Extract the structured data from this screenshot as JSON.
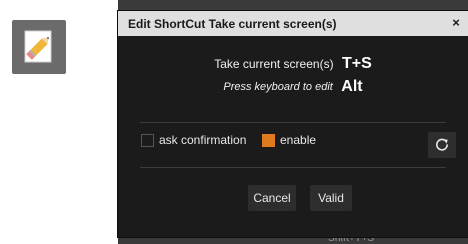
{
  "app_icon": {
    "icon": "pencil-icon",
    "background": "#6b6b6b"
  },
  "backdrop": {
    "hint_text": "Shift+T+S"
  },
  "dialog": {
    "title": "Edit ShortCut Take current screen(s)",
    "close_label": "×",
    "action_name": "Take current screen(s)",
    "shortcut": "T+S",
    "edit_hint": "Press keyboard to edit",
    "pressed_key": "Alt",
    "options": {
      "confirm": {
        "label": "ask confirmation",
        "checked": false
      },
      "enable": {
        "label": "enable",
        "checked": true
      }
    },
    "reset_icon": "reset-icon",
    "buttons": {
      "cancel_label": "Cancel",
      "valid_label": "Valid"
    }
  },
  "colors": {
    "accent": "#e07a1f",
    "dialog_bg": "#1b1b1b",
    "titlebar_bg": "#dfdfdf"
  }
}
